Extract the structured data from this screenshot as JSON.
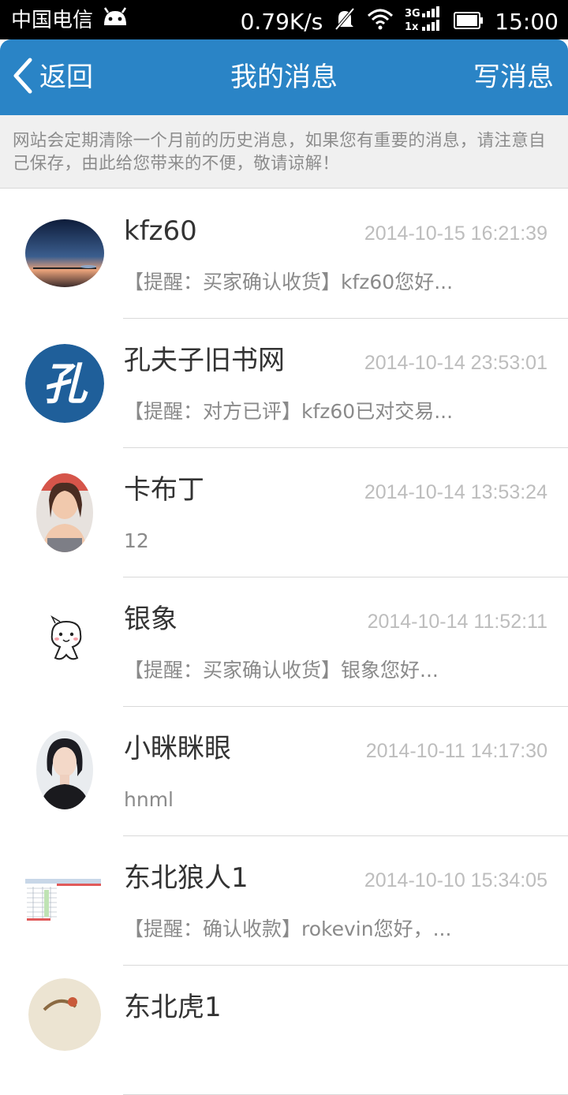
{
  "status_bar": {
    "carrier": "中国电信",
    "speed": "0.79K/s",
    "network": "3G 1x",
    "time": "15:00"
  },
  "nav": {
    "back_label": "返回",
    "title": "我的消息",
    "compose_label": "写消息"
  },
  "notice": "网站会定期清除一个月前的历史消息，如果您有重要的消息，请注意自己保存，由此给您带来的不便，敬请谅解！",
  "messages": [
    {
      "name": "kfz60",
      "time": "2014-10-15 16:21:39",
      "preview": "【提醒：买家确认收货】kfz60您好...",
      "avatar": "sunset-photo"
    },
    {
      "name": "孔夫子旧书网",
      "time": "2014-10-14 23:53:01",
      "preview": "【提醒：对方已评】kfz60已对交易...",
      "avatar": "kong-logo",
      "avatar_char": "孔"
    },
    {
      "name": "卡布丁",
      "time": "2014-10-14 13:53:24",
      "preview": "12",
      "avatar": "woman-photo"
    },
    {
      "name": "银象",
      "time": "2014-10-14 11:52:11",
      "preview": "【提醒：买家确认收货】银象您好...",
      "avatar": "cartoon-cat"
    },
    {
      "name": "小眯眯眼",
      "time": "2014-10-11 14:17:30",
      "preview": "hnml",
      "avatar": "portrait-photo"
    },
    {
      "name": "东北狼人1",
      "time": "2014-10-10 15:34:05",
      "preview": "【提醒：确认收款】rokevin您好，...",
      "avatar": "spreadsheet-screenshot"
    },
    {
      "name": "东北虎1",
      "time": "",
      "preview": "",
      "avatar": "painting-photo"
    }
  ]
}
